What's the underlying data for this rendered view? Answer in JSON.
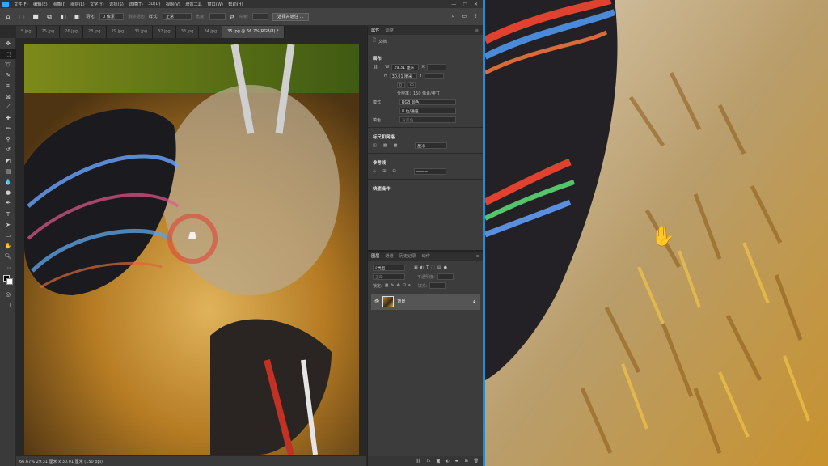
{
  "menubar": {
    "items": [
      "文件(F)",
      "编辑(E)",
      "图像(I)",
      "图层(L)",
      "文字(Y)",
      "选择(S)",
      "滤镜(T)",
      "3D(D)",
      "视图(V)",
      "增效工具",
      "窗口(W)",
      "帮助(H)"
    ]
  },
  "options": {
    "feather_label": "羽化:",
    "feather_value": "0 像素",
    "antialias": "消除锯齿",
    "style_label": "样式:",
    "style_value": "正常",
    "width_label": "宽度:",
    "height_label": "高度:",
    "select_btn": "选择并遮住 ..."
  },
  "tabs": [
    "5.jpg",
    "25.jpg",
    "26.jpg",
    "28.jpg",
    "29.jpg",
    "31.jpg",
    "32.jpg",
    "33.jpg",
    "34.jpg",
    "35.jpg @ 66.7%(RGB/8) *"
  ],
  "status": {
    "text": "66.67%   29.31 厘米 x 30.01 厘米 (150 ppi)"
  },
  "properties": {
    "tab_props": "属性",
    "tab_adjust": "调整",
    "doc_label": "文档",
    "canvas_title": "画布",
    "w_label": "W",
    "w_value": "29.31 厘米",
    "x_label": "X",
    "h_label": "H",
    "h_value": "30.01 厘米",
    "y_label": "Y",
    "resolution": "分辨率：150 像素/英寸",
    "mode_label": "模式",
    "mode_value": "RGB 颜色",
    "depth_value": "8 位/通道",
    "fill_label": "填色",
    "fill_value": "背景色",
    "rulers_title": "标尺和网格",
    "units_value": "厘米",
    "guides_title": "参考线",
    "quick_title": "快速操作"
  },
  "layers": {
    "tabs": [
      "图层",
      "通道",
      "历史记录",
      "动作"
    ],
    "kind_label": "类型",
    "blend_value": "正常",
    "opacity_label": "不透明度:",
    "lock_label": "锁定:",
    "fill_label": "填充:",
    "layer_name": "背景"
  },
  "colors": {
    "accent": "#31a8ff",
    "panel": "#3c3c3c",
    "highlight_ring": "#e0453a"
  }
}
